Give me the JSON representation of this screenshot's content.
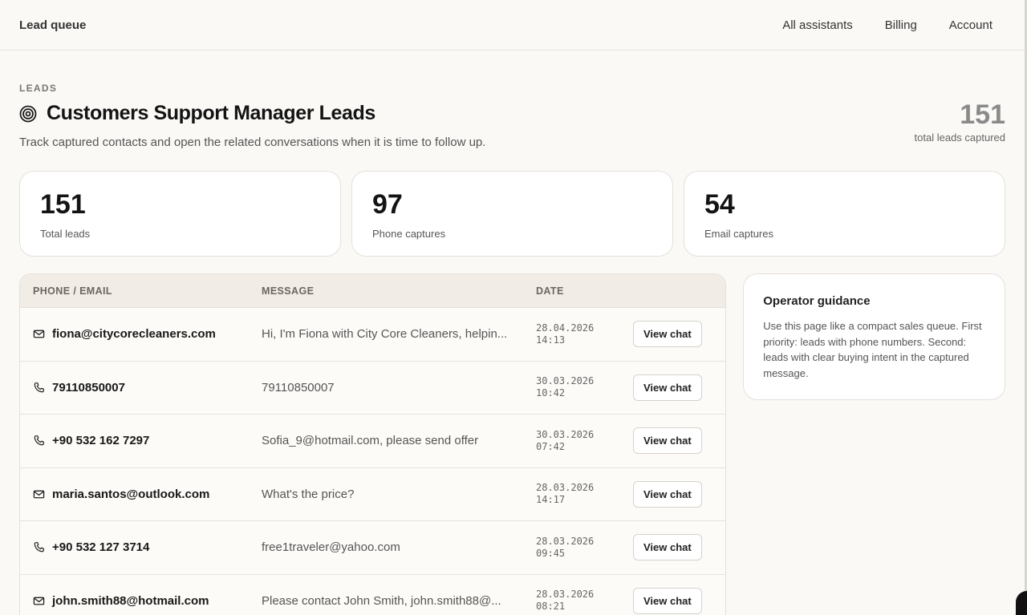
{
  "topbar": {
    "brand": "Lead queue",
    "nav": [
      "All assistants",
      "Billing",
      "Account"
    ]
  },
  "header": {
    "eyebrow": "LEADS",
    "title": "Customers Support Manager Leads",
    "subtitle": "Track captured contacts and open the related conversations when it is time to follow up.",
    "total_value": "151",
    "total_label": "total leads captured"
  },
  "stats": [
    {
      "value": "151",
      "label": "Total leads"
    },
    {
      "value": "97",
      "label": "Phone captures"
    },
    {
      "value": "54",
      "label": "Email captures"
    }
  ],
  "table": {
    "columns": [
      "PHONE / EMAIL",
      "MESSAGE",
      "DATE"
    ],
    "button_label": "View chat",
    "rows": [
      {
        "type": "email",
        "contact": "fiona@citycorecleaners.com",
        "message": "Hi, I'm Fiona with City Core Cleaners, helpin...",
        "date": "28.04.2026",
        "time": "14:13"
      },
      {
        "type": "phone",
        "contact": "79110850007",
        "message": "79110850007",
        "date": "30.03.2026",
        "time": "10:42"
      },
      {
        "type": "phone",
        "contact": "+90 532 162 7297",
        "message": "Sofia_9@hotmail.com, please send offer",
        "date": "30.03.2026",
        "time": "07:42"
      },
      {
        "type": "email",
        "contact": "maria.santos@outlook.com",
        "message": "What's the price?",
        "date": "28.03.2026",
        "time": "14:17"
      },
      {
        "type": "phone",
        "contact": "+90 532 127 3714",
        "message": "free1traveler@yahoo.com",
        "date": "28.03.2026",
        "time": "09:45"
      },
      {
        "type": "email",
        "contact": "john.smith88@hotmail.com",
        "message": "Please contact John Smith, john.smith88@...",
        "date": "28.03.2026",
        "time": "08:21"
      }
    ]
  },
  "guidance": {
    "title": "Operator guidance",
    "text": "Use this page like a compact sales queue. First priority: leads with phone numbers. Second: leads with clear buying intent in the captured message."
  }
}
